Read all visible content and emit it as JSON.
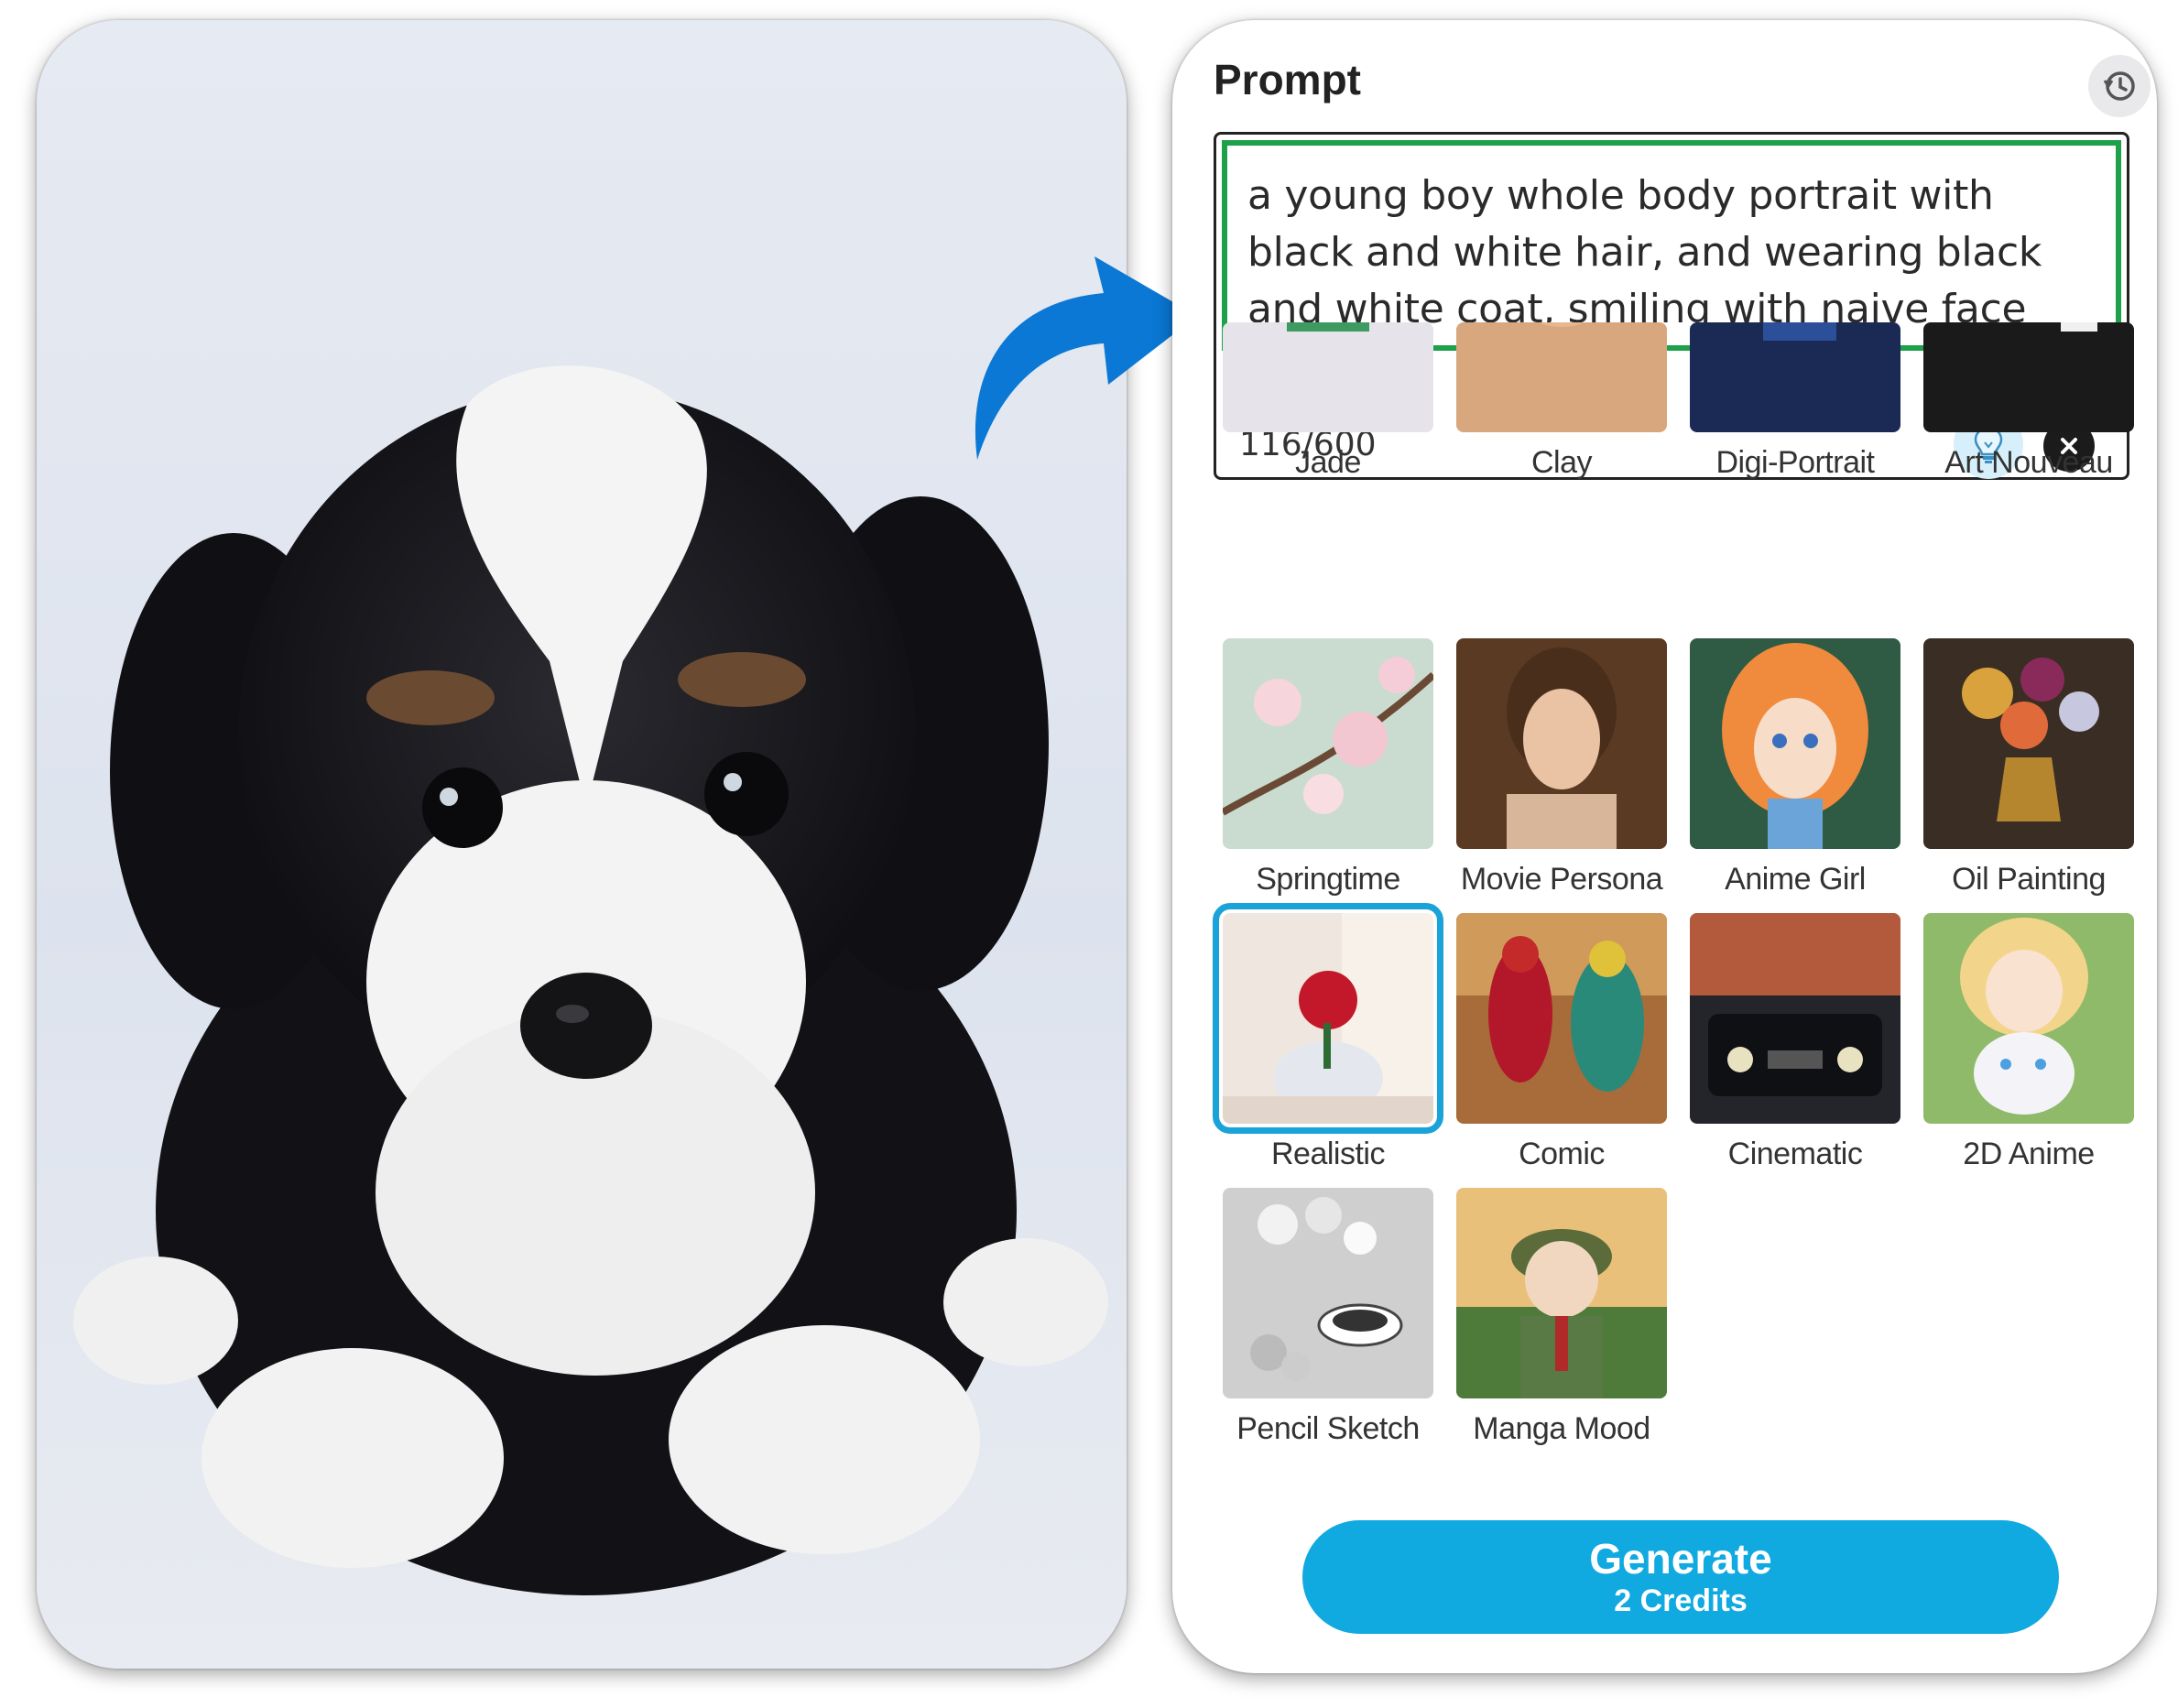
{
  "prompt": {
    "title": "Prompt",
    "text": "a young boy whole body portrait with black and white hair, and wearing black and white coat, smiling with naive face",
    "char_count": "116/600"
  },
  "icons": {
    "history": "history-clock-icon",
    "bulb": "lightbulb-icon",
    "clear": "close-icon",
    "arrow": "curved-arrow-icon"
  },
  "styles": [
    {
      "label": "Jade"
    },
    {
      "label": "Clay"
    },
    {
      "label": "Digi-Portrait"
    },
    {
      "label": "Art Nouveau"
    },
    {
      "label": "Springtime"
    },
    {
      "label": "Movie Persona"
    },
    {
      "label": "Anime Girl"
    },
    {
      "label": "Oil Painting"
    },
    {
      "label": "Realistic",
      "selected": true
    },
    {
      "label": "Comic"
    },
    {
      "label": "Cinematic"
    },
    {
      "label": "2D Anime"
    },
    {
      "label": "Pencil Sketch"
    },
    {
      "label": "Manga Mood"
    }
  ],
  "generate": {
    "label": "Generate",
    "credits": "2 Credits"
  },
  "colors": {
    "accent": "#10a9e0",
    "prompt_border": "#1fa04b",
    "arrow": "#0a78d4"
  }
}
